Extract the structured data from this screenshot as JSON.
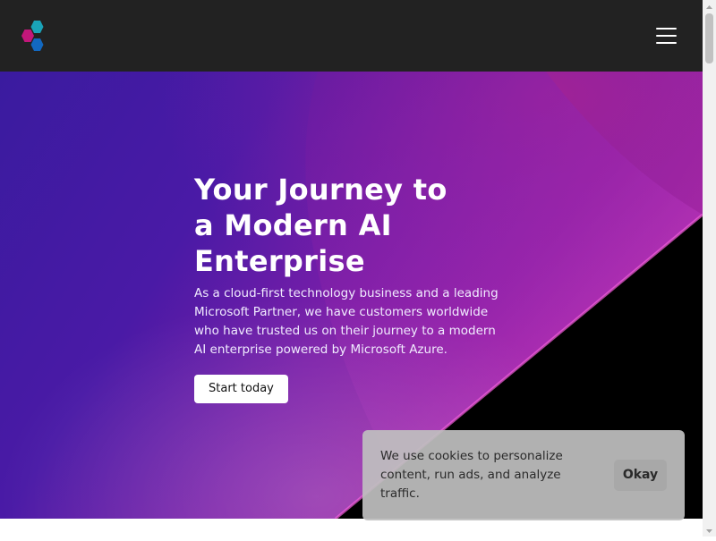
{
  "header": {
    "logo_icon": "hexagon-cluster-logo",
    "menu_icon": "hamburger-menu-icon",
    "colors": {
      "background": "#222222",
      "logo_magenta": "#c2177a",
      "logo_teal": "#1aa3b8",
      "logo_blue": "#1268c0"
    }
  },
  "hero": {
    "title": "Your Journey to a Modern AI Enterprise",
    "description": "As a cloud-first technology business and a leading Microsoft Partner, we have customers worldwide who have trusted us on their journey to a modern AI enterprise powered by Microsoft Azure.",
    "cta_label": "Start today",
    "colors": {
      "gradient_start": "#3a1a9e",
      "gradient_mid": "#7b1fa2",
      "gradient_end": "#e040c8",
      "corner": "#000000"
    }
  },
  "cookie_banner": {
    "text": "We use cookies to personalize content, run ads, and analyze traffic.",
    "accept_label": "Okay"
  }
}
